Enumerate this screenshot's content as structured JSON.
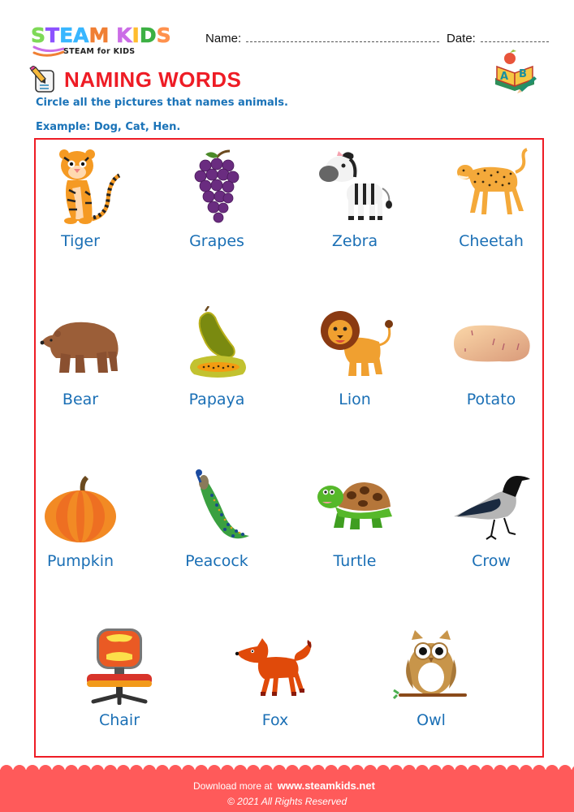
{
  "brand": {
    "logo_letters": [
      {
        "char": "S",
        "color": "#7ed957"
      },
      {
        "char": "T",
        "color": "#8c52ff"
      },
      {
        "char": "E",
        "color": "#38b6ff"
      },
      {
        "char": "A",
        "color": "#38b6ff"
      },
      {
        "char": "M",
        "color": "#f07f34"
      },
      {
        "char": " ",
        "color": "#ffffff"
      },
      {
        "char": "K",
        "color": "#cb6ce6"
      },
      {
        "char": "I",
        "color": "#ffbd2e"
      },
      {
        "char": "D",
        "color": "#3cb043"
      },
      {
        "char": "S",
        "color": "#ff914d"
      }
    ],
    "tagline": "STEAM for KIDS"
  },
  "header": {
    "name_label": "Name:",
    "date_label": "Date:",
    "abc_icon": "book-abc-icon"
  },
  "worksheet": {
    "title_icon": "pencil-document-icon",
    "title": "NAMING WORDS",
    "instruction": "Circle all the pictures that names animals.",
    "example": "Example: Dog, Cat, Hen.",
    "frame_color": "#ee1c25",
    "label_color": "#1a6fb5",
    "items": [
      {
        "label": "Tiger",
        "icon": "tiger-icon"
      },
      {
        "label": "Grapes",
        "icon": "grapes-icon"
      },
      {
        "label": "Zebra",
        "icon": "zebra-icon"
      },
      {
        "label": "Cheetah",
        "icon": "cheetah-icon"
      },
      {
        "label": "Bear",
        "icon": "bear-icon"
      },
      {
        "label": "Papaya",
        "icon": "papaya-icon"
      },
      {
        "label": "Lion",
        "icon": "lion-icon"
      },
      {
        "label": "Potato",
        "icon": "potato-icon"
      },
      {
        "label": "Pumpkin",
        "icon": "pumpkin-icon"
      },
      {
        "label": "Peacock",
        "icon": "peacock-icon"
      },
      {
        "label": "Turtle",
        "icon": "turtle-icon"
      },
      {
        "label": "Crow",
        "icon": "crow-icon"
      },
      {
        "label": "Chair",
        "icon": "chair-icon"
      },
      {
        "label": "Fox",
        "icon": "fox-icon"
      },
      {
        "label": "Owl",
        "icon": "owl-icon"
      }
    ]
  },
  "footer": {
    "download_text": "Download more at",
    "url": "www.steamkids.net",
    "copyright": "©  2021 All Rights Reserved",
    "background": "#ff5a5a"
  }
}
